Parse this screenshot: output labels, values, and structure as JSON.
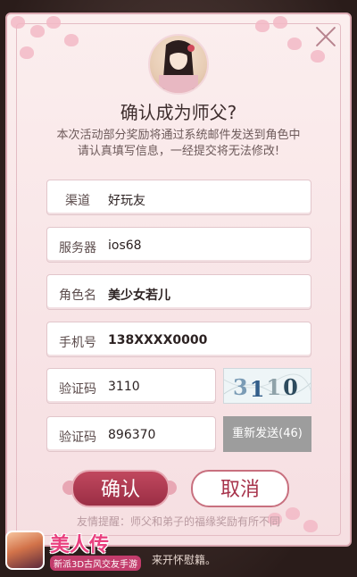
{
  "dialog": {
    "title": "确认成为师父?",
    "notice_line1": "本次活动部分奖励将通过系统邮件发送到角色中",
    "notice_line2": "请认真填写信息，一经提交将无法修改!",
    "close_icon": "close-icon"
  },
  "form": {
    "channel": {
      "label": "渠道",
      "value": "好玩友"
    },
    "server": {
      "label": "服务器",
      "value": "ios68"
    },
    "role": {
      "label": "角色名",
      "value": "美少女若儿"
    },
    "phone": {
      "label": "手机号",
      "value": "138XXXX0000"
    },
    "captcha": {
      "label": "验证码",
      "value": "3110",
      "image_text": "3110"
    },
    "sms_code": {
      "label": "验证码",
      "value": "896370"
    },
    "resend_label": "重新发送(46)"
  },
  "buttons": {
    "confirm": "确认",
    "cancel": "取消"
  },
  "tip": "友情提醒：师父和弟子的福缘奖励有所不同",
  "background_text": "来开怀慰籍。",
  "ad": {
    "title": "美人传",
    "subtitle": "新派3D古风交友手游"
  },
  "colors": {
    "accent": "#9b2e45",
    "dialog_bg": "#fbeeee",
    "resend_bg": "#9d9d9d"
  }
}
